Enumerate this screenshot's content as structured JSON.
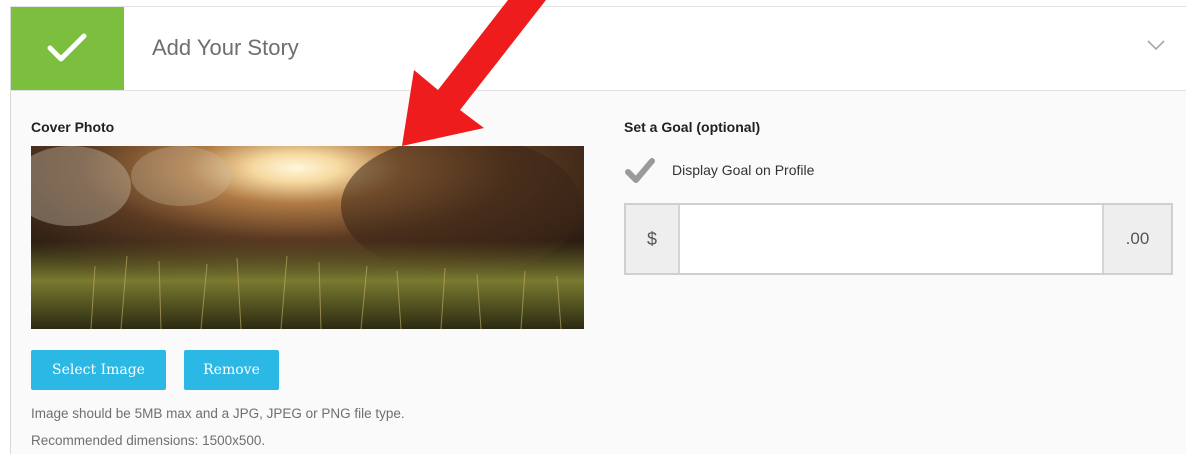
{
  "header": {
    "title": "Add Your Story",
    "accent_color": "#7cbf3f",
    "status_icon": "check-icon",
    "toggle_icon": "chevron-down-icon"
  },
  "cover_photo": {
    "label": "Cover Photo",
    "select_button": "Select Image",
    "remove_button": "Remove",
    "help_line_1": "Image should be 5MB max and a JPG, JPEG or PNG file type.",
    "help_line_2": "Recommended dimensions: 1500x500.",
    "button_color": "#2bb8e4"
  },
  "goal": {
    "label": "Set a Goal (optional)",
    "display_checkbox_label": "Display Goal on Profile",
    "display_checked": true,
    "currency_prefix": "$",
    "amount_value": "",
    "cents_suffix": ".00"
  },
  "annotation": {
    "arrow_color": "#ee1c1c",
    "arrow_icon": "red-arrow-icon"
  }
}
